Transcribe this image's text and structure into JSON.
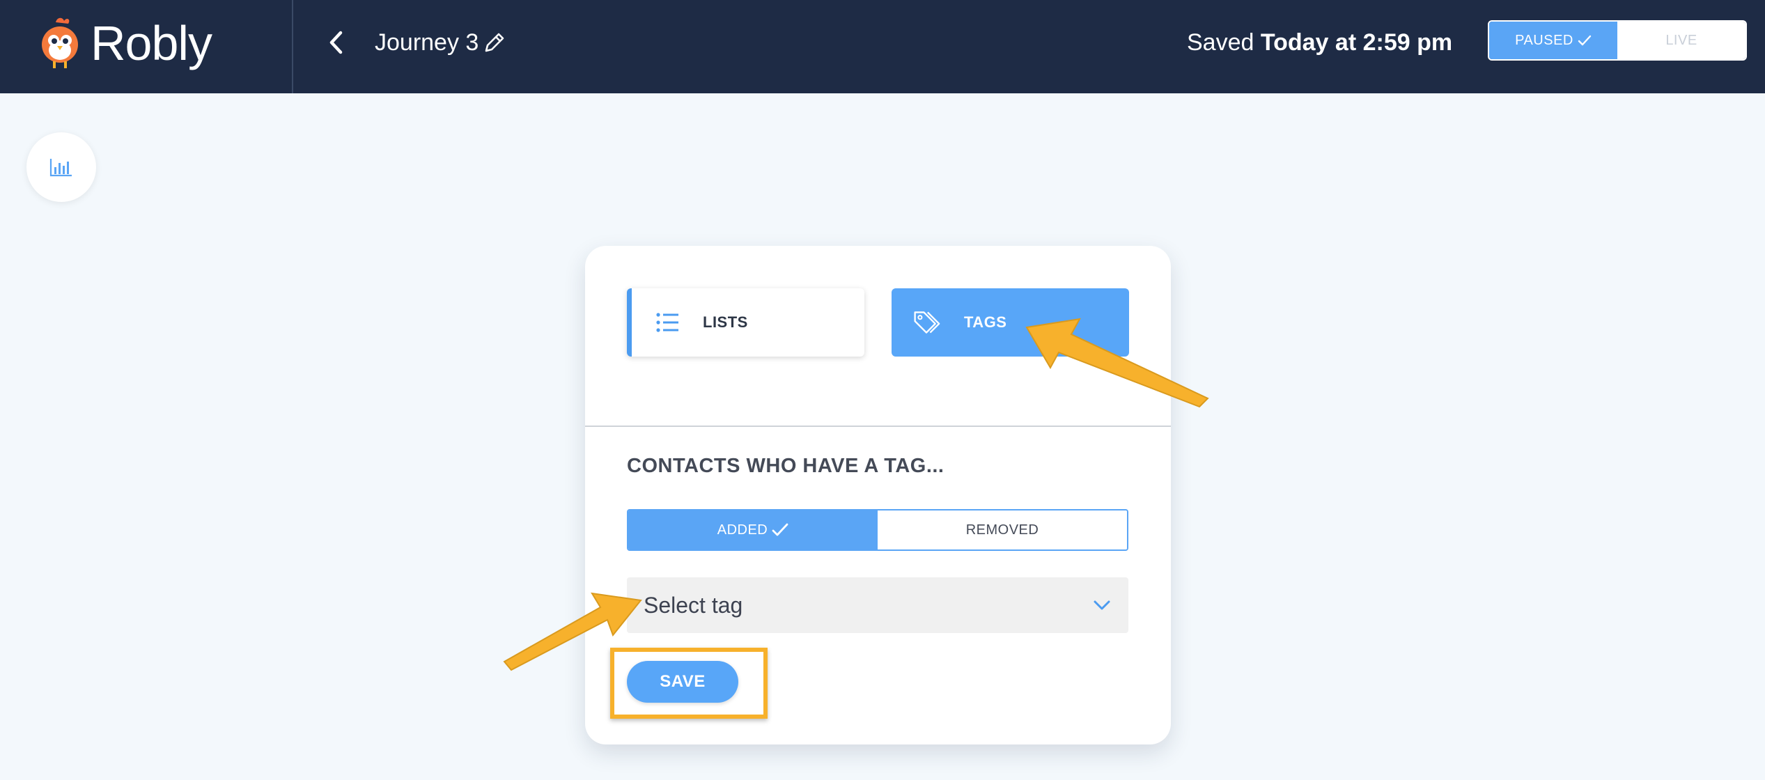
{
  "app": {
    "brand": "Robly",
    "journey_title": "Journey 3",
    "saved_prefix": "Saved",
    "saved_time": "Today at 2:59 pm",
    "status_toggle": {
      "paused_label": "PAUSED",
      "live_label": "LIVE",
      "selected": "PAUSED"
    }
  },
  "icons": {
    "back": "chevron-left-icon",
    "edit": "pencil-icon",
    "stats": "bar-chart-icon",
    "lists": "list-icon",
    "tags": "tag-icon",
    "select": "chevron-down-icon",
    "check": "check-icon"
  },
  "card": {
    "type_options": [
      {
        "label": "LISTS",
        "selected": false
      },
      {
        "label": "TAGS",
        "selected": true
      }
    ],
    "section_title": "CONTACTS WHO HAVE A TAG...",
    "tag_action_toggle": {
      "added_label": "ADDED",
      "removed_label": "REMOVED",
      "selected": "ADDED"
    },
    "select_tag_placeholder": "Select tag",
    "save_label": "SAVE"
  },
  "colors": {
    "topbar": "#1e2b45",
    "accent": "#58a6f8",
    "background": "#f3f8fc",
    "annotation": "#f7b12c"
  }
}
